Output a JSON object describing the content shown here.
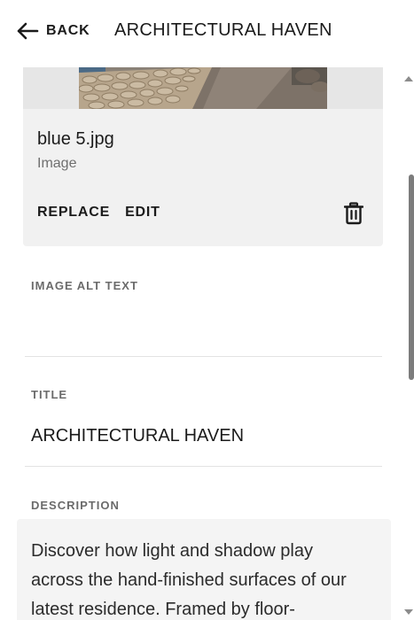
{
  "header": {
    "back_label": "BACK",
    "title": "ARCHITECTURAL HAVEN"
  },
  "image_card": {
    "file_name": "blue 5.jpg",
    "file_type": "Image",
    "actions": {
      "replace": "REPLACE",
      "edit": "EDIT"
    },
    "delete_icon": "trash-icon"
  },
  "fields": {
    "alt_text": {
      "label": "IMAGE ALT TEXT",
      "value": ""
    },
    "title": {
      "label": "TITLE",
      "value": "ARCHITECTURAL HAVEN"
    },
    "description": {
      "label": "DESCRIPTION",
      "value": "Discover how light and shadow play across the hand-finished surfaces of our latest residence. Framed by floor-"
    }
  },
  "colors": {
    "text": "#1b1b1b",
    "muted": "#6b6b6b",
    "card_bg": "#f1f1f1",
    "divider": "#e3e3e3",
    "scroll_thumb": "#7c7c7c"
  }
}
